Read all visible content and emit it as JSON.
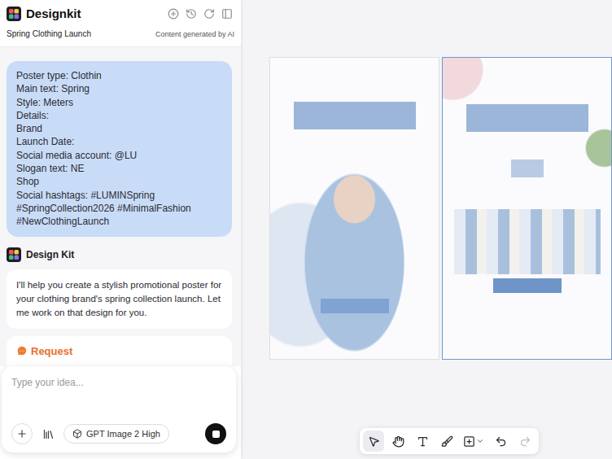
{
  "app": {
    "name": "Designkit"
  },
  "project": {
    "title": "Spring Clothing Launch",
    "note": "Content generated by AI"
  },
  "user_message": {
    "lines": [
      "Poster type: Clothin",
      "Main text: Spring",
      "Style: Meters",
      "Details:",
      "Brand",
      "Launch Date:",
      "Social media account: @LU",
      "Slogan text: NE",
      "Shop",
      "Social hashtags: #LUMINSpring",
      "#SpringCollection2026 #MinimalFashion",
      "#NewClothingLaunch"
    ]
  },
  "assistant_message": {
    "author": "Design Kit",
    "text": "I'll help you create a stylish promotional poster for your clothing brand's spring collection launch. Let me work on that design for you."
  },
  "request": {
    "label": "Request"
  },
  "input": {
    "placeholder": "Type your idea...",
    "model": "GPT Image 2 High",
    "generating": true
  },
  "posters": [
    {
      "selected": false
    },
    {
      "selected": true
    }
  ],
  "toolbar": [
    {
      "kind": "select",
      "selected": true,
      "disabled": false
    },
    {
      "kind": "hand",
      "selected": false,
      "disabled": false
    },
    {
      "kind": "text",
      "selected": false,
      "disabled": false
    },
    {
      "kind": "brush",
      "selected": false,
      "disabled": false
    },
    {
      "kind": "insert",
      "selected": false,
      "disabled": false
    },
    {
      "kind": "undo",
      "selected": false,
      "disabled": false
    },
    {
      "kind": "redo",
      "selected": false,
      "disabled": true
    }
  ]
}
